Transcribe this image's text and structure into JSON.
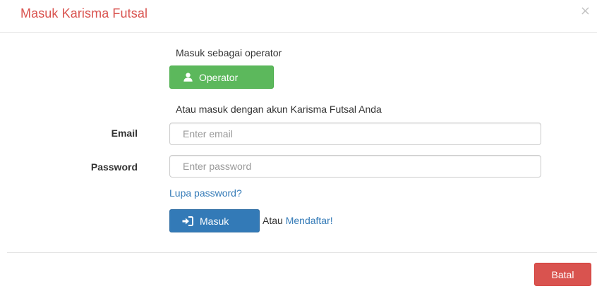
{
  "modal": {
    "title": "Masuk Karisma Futsal",
    "close_glyph": "×"
  },
  "operator": {
    "intro": "Masuk sebagai operator",
    "button_label": "Operator",
    "button_icon": "user-icon"
  },
  "account": {
    "intro": "Atau masuk dengan akun Karisma Futsal Anda"
  },
  "form": {
    "email_label": "Email",
    "email_placeholder": "Enter email",
    "email_value": "",
    "password_label": "Password",
    "password_placeholder": "Enter password",
    "password_value": "",
    "forgot_link": "Lupa password?",
    "submit_label": "Masuk",
    "submit_icon": "sign-in-icon",
    "or_text": "Atau",
    "register_link": "Mendaftar!"
  },
  "footer": {
    "cancel_label": "Batal"
  },
  "colors": {
    "title": "#d9534f",
    "operator_button": "#5cb85c",
    "submit_button": "#337ab7",
    "cancel_button": "#d9534f",
    "link": "#337ab7"
  }
}
